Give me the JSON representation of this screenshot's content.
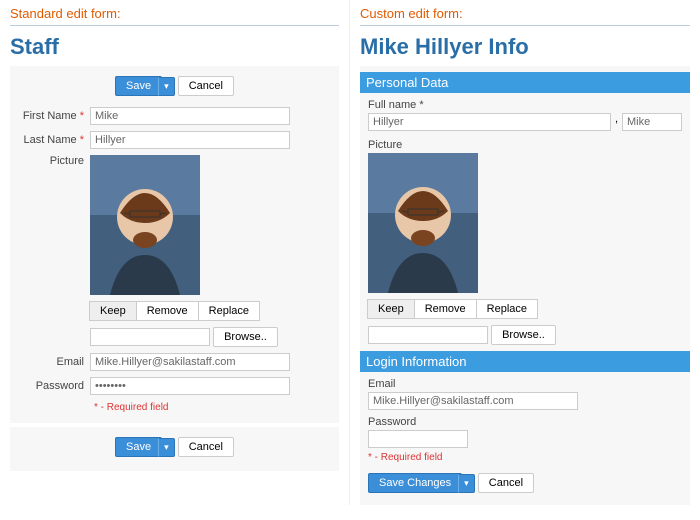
{
  "left": {
    "caption": "Standard edit form:",
    "title": "Staff",
    "save": "Save",
    "cancel": "Cancel",
    "fields": {
      "first_name_label": "First Name",
      "first_name_value": "Mike",
      "last_name_label": "Last Name",
      "last_name_value": "Hillyer",
      "picture_label": "Picture",
      "keep": "Keep",
      "remove": "Remove",
      "replace": "Replace",
      "browse": "Browse..",
      "email_label": "Email",
      "email_value": "Mike.Hillyer@sakilastaff.com",
      "password_label": "Password",
      "password_value": "••••••••"
    },
    "required_note": "* - Required field"
  },
  "right": {
    "caption": "Custom edit form:",
    "title": "Mike Hillyer Info",
    "sections": {
      "personal": "Personal Data",
      "login": "Login Information"
    },
    "fields": {
      "fullname_label": "Full name *",
      "fullname_last": "Hillyer",
      "fullname_first": "Mike",
      "picture_label": "Picture",
      "keep": "Keep",
      "remove": "Remove",
      "replace": "Replace",
      "browse": "Browse..",
      "email_label": "Email",
      "email_value": "Mike.Hillyer@sakilastaff.com",
      "password_label": "Password",
      "password_value": ""
    },
    "required_note": "* - Required field",
    "save_changes": "Save Changes",
    "cancel": "Cancel"
  }
}
